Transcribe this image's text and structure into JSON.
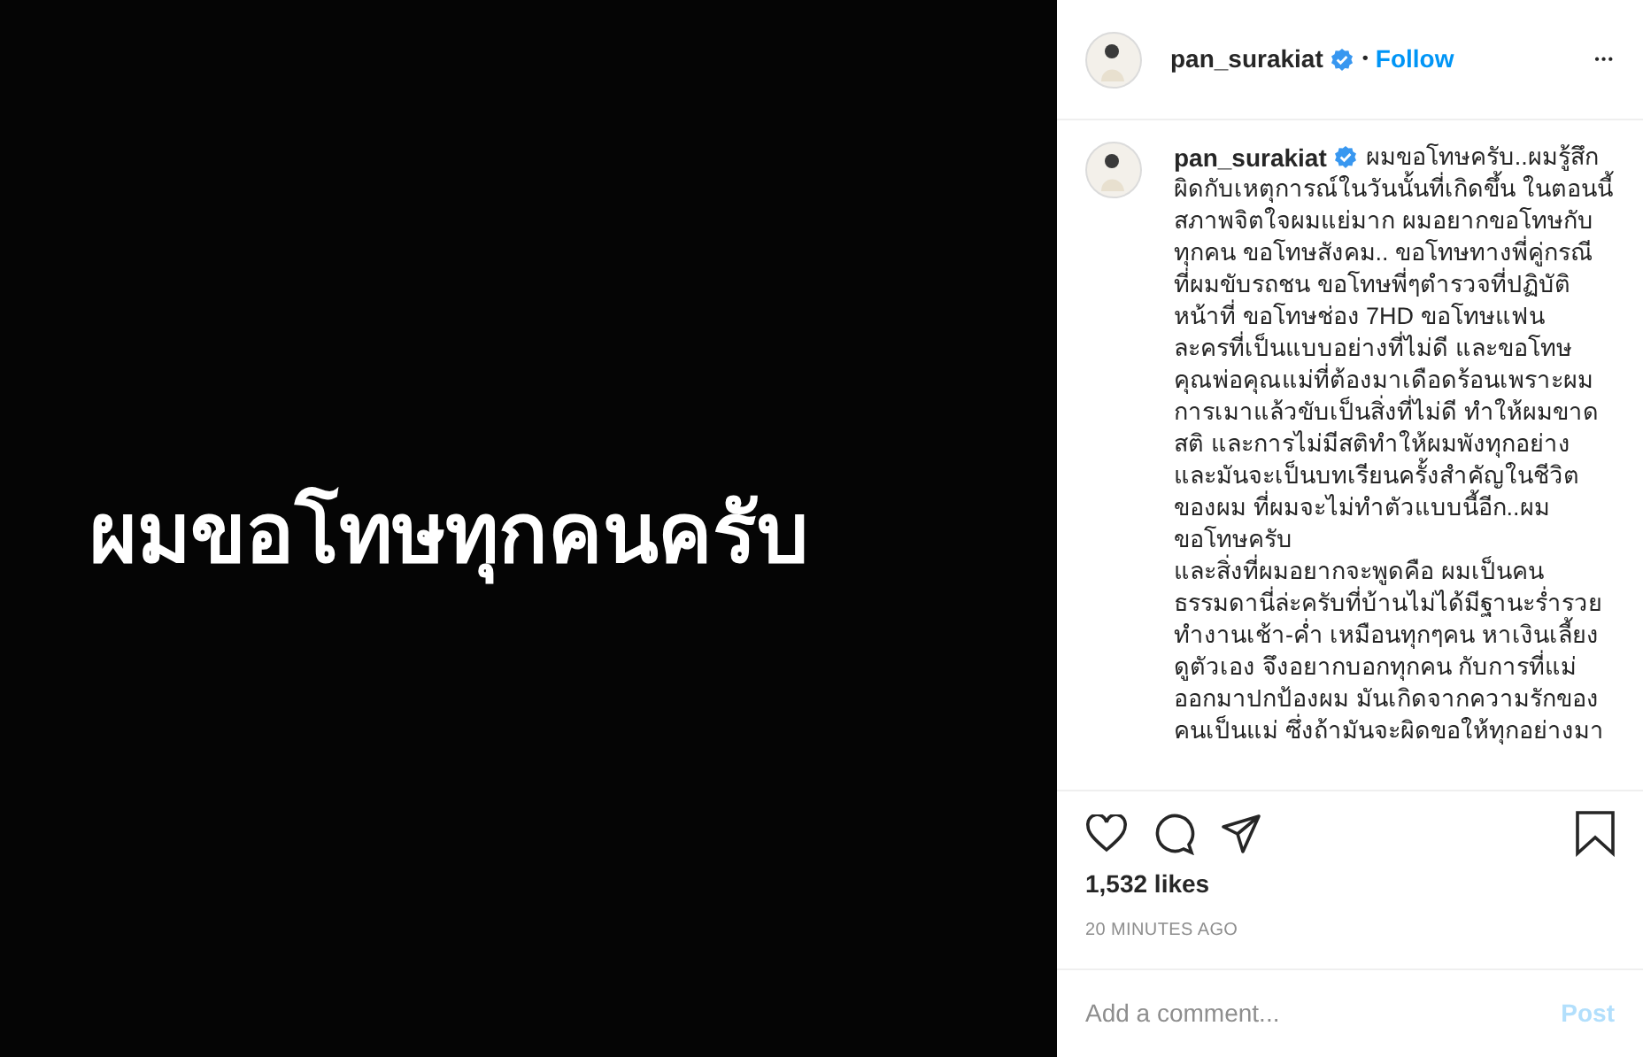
{
  "post_image": {
    "text": "ผมขอโทษทุกคนครับ"
  },
  "header": {
    "username": "pan_surakiat",
    "verified": true,
    "separator": "•",
    "follow": "Follow",
    "more": "•••"
  },
  "caption": {
    "username": "pan_surakiat",
    "verified": true,
    "lines": [
      "ผมขอโทษครับ..ผมรู้สึก",
      "ผิดกับเหตุการณ์ในวันนั้นที่เกิดขึ้น ในตอนนี้",
      "สภาพจิตใจผมแย่มาก ผมอยากขอโทษกับ",
      "ทุกคน ขอโทษสังคม.. ขอโทษทางพี่คู่กรณี",
      "ที่ผมขับรถชน ขอโทษพี่ๆตำรวจที่ปฏิบัติ",
      "หน้าที่ ขอโทษช่อง 7HD ขอโทษแฟน",
      "ละครที่เป็นแบบอย่างที่ไม่ดี และขอโทษ",
      "คุณพ่อคุณแม่ที่ต้องมาเดือดร้อนเพราะผม",
      "การเมาแล้วขับเป็นสิ่งที่ไม่ดี ทำให้ผมขาด",
      "สติ และการไม่มีสติทำให้ผมพังทุกอย่าง",
      "และมันจะเป็นบทเรียนครั้งสำคัญในชีวิต",
      "ของผม ที่ผมจะไม่ทำตัวแบบนี้อีก..ผม",
      "ขอโทษครับ",
      "และสิ่งที่ผมอยากจะพูดคือ ผมเป็นคน",
      "ธรรมดานี่ล่ะครับที่บ้านไม่ได้มีฐานะร่ำรวย",
      "ทำงานเช้า-ค่ำ เหมือนทุกๆคน หาเงินเลี้ยง",
      "ดูตัวเอง จึงอยากบอกทุกคน กับการที่แม่",
      "ออกมาปกป้องผม มันเกิดจากความรักของ",
      "คนเป็นแม่ ซึ่งถ้ามันจะผิดขอให้ทุกอย่างมา"
    ]
  },
  "likes": "1,532 likes",
  "time": "20 MINUTES AGO",
  "comment": {
    "placeholder": "Add a comment...",
    "post": "Post",
    "post_disabled": true
  }
}
